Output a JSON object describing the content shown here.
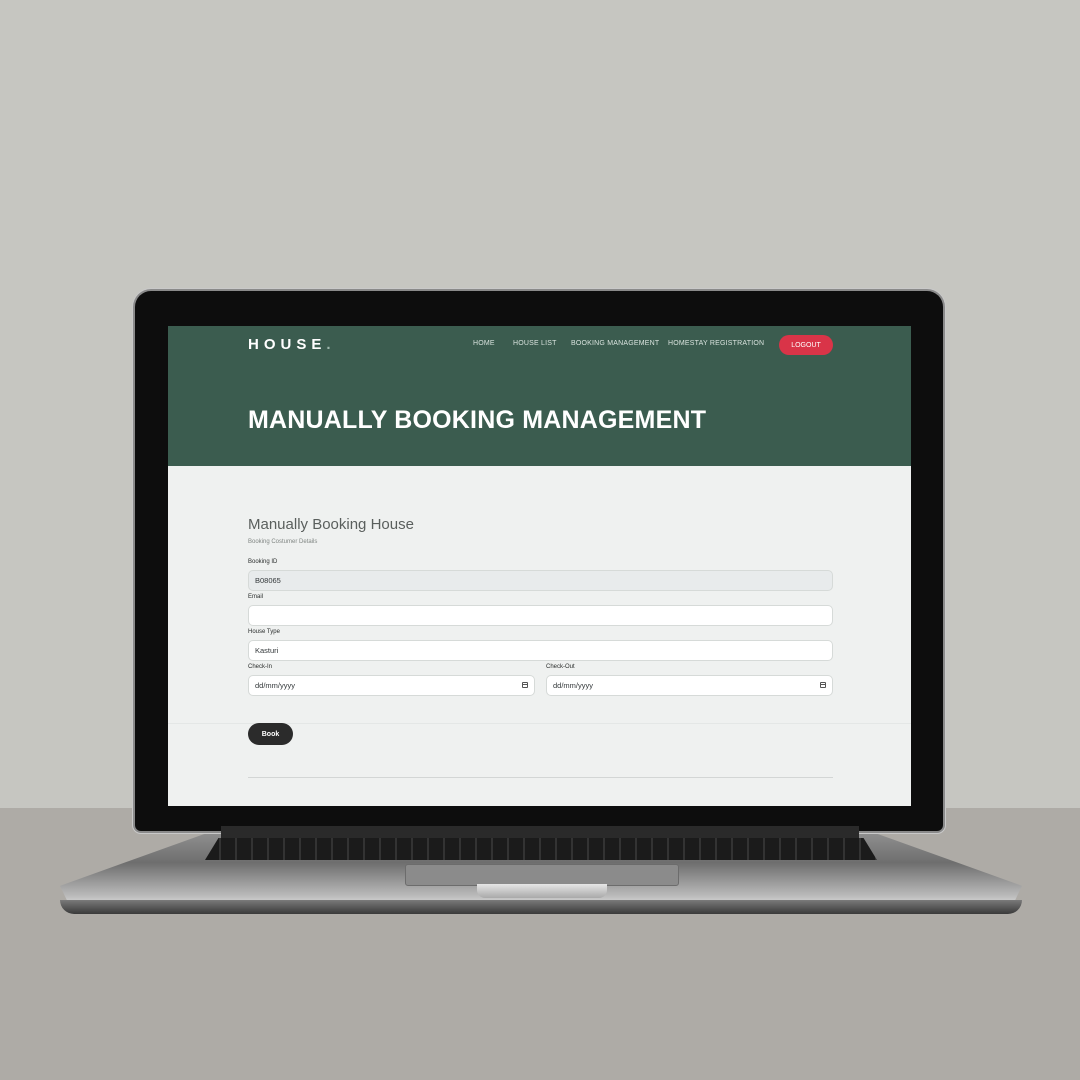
{
  "header": {
    "brand": "HOUSE",
    "brand_dot": ".",
    "nav": {
      "home": "HOME",
      "house_list": "HOUSE LIST",
      "booking_management": "BOOKING MANAGEMENT",
      "homestay_registration": "HOMESTAY REGISTRATION"
    },
    "logout": "LOGOUT",
    "hero_title": "MANUALLY BOOKING MANAGEMENT"
  },
  "form": {
    "title": "Manually Booking House",
    "subtitle": "Booking Costumer Details",
    "booking_id": {
      "label": "Booking ID",
      "value": "B08065"
    },
    "email": {
      "label": "Email",
      "value": ""
    },
    "house_type": {
      "label": "House Type",
      "value": "Kasturi"
    },
    "check_in": {
      "label": "Check-In",
      "placeholder": "dd/mm/yyyy"
    },
    "check_out": {
      "label": "Check-Out",
      "placeholder": "dd/mm/yyyy"
    },
    "book_label": "Book"
  },
  "colors": {
    "hero": "#3b5c4f",
    "logout": "#d93448",
    "book_button": "#2b2b2b",
    "page_bg": "#eff1f0"
  },
  "icons": [
    "calendar-icon"
  ]
}
